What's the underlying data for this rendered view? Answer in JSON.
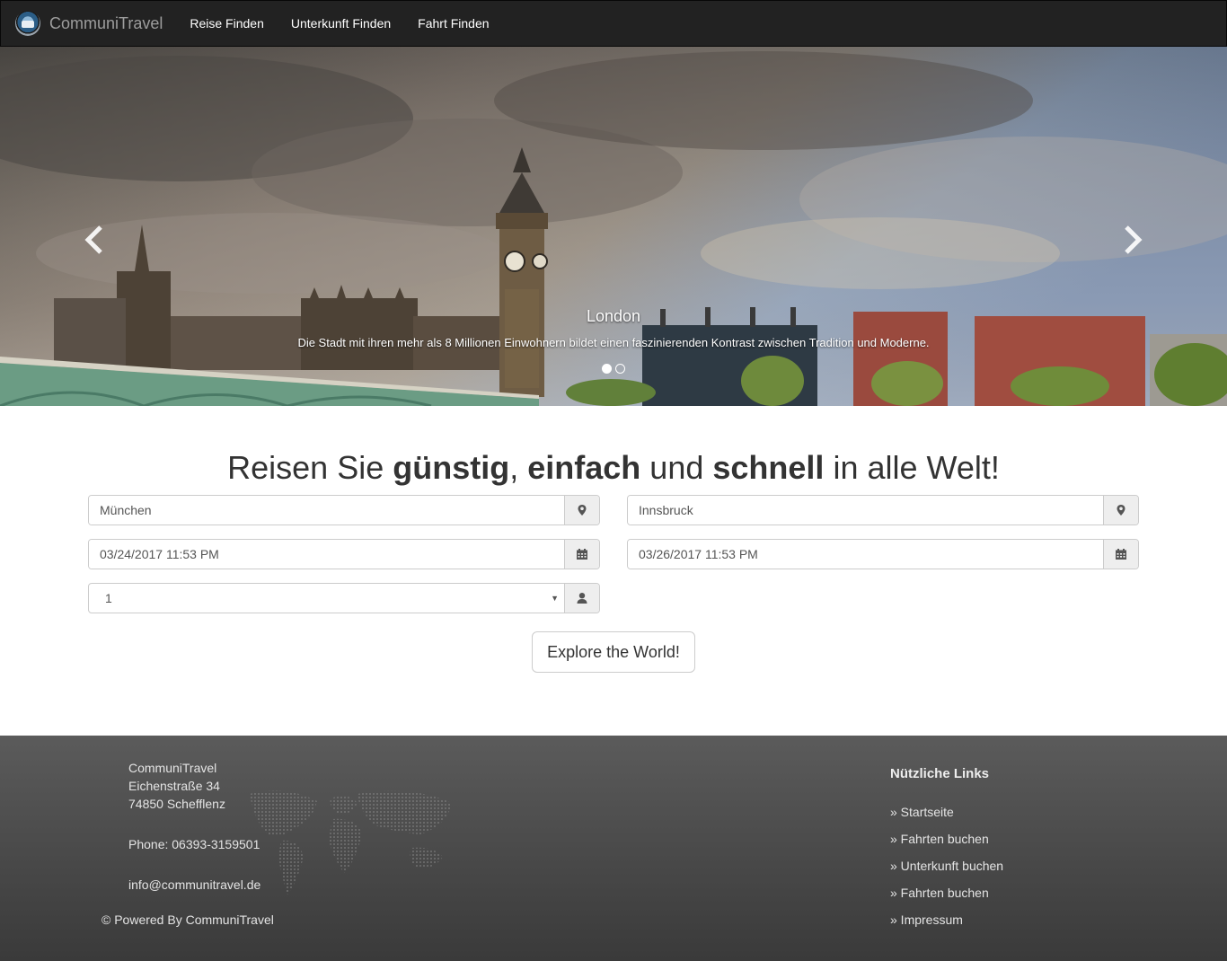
{
  "navbar": {
    "brand": "CommuniTravel",
    "links": [
      "Reise Finden",
      "Unterkunft Finden",
      "Fahrt Finden"
    ]
  },
  "carousel": {
    "caption_title": "London",
    "caption_text": "Die Stadt mit ihren mehr als 8 Millionen Einwohnern bildet einen faszinierenden Kontrast zwischen Tradition und Moderne.",
    "slide_count": 2,
    "active_slide": 1
  },
  "search": {
    "headline": {
      "part1": "Reisen Sie ",
      "bold1": "günstig",
      "part2": ", ",
      "bold2": "einfach",
      "part3": " und ",
      "bold3": "schnell",
      "part4": " in alle Welt!"
    },
    "from": "München",
    "to": "Innsbruck",
    "depart": "03/24/2017 11:53 PM",
    "return": "03/26/2017 11:53 PM",
    "persons": "1",
    "submit": "Explore the World!"
  },
  "footer": {
    "company": "CommuniTravel",
    "street": "Eichenstraße 34",
    "city": "74850 Schefflenz",
    "phone": "Phone: 06393-3159501",
    "email": "info@communitravel.de",
    "powered": "© Powered By CommuniTravel",
    "links_title": "Nützliche Links",
    "links": [
      "» Startseite",
      "» Fahrten buchen",
      "» Unterkunft buchen",
      "» Fahrten buchen",
      "» Impressum"
    ]
  },
  "colors": {
    "navbar_bg": "#222222",
    "footer_bg": "#4a4a4a",
    "text_dark": "#333333"
  },
  "icons": [
    "map-marker-icon",
    "calendar-icon",
    "user-icon",
    "chevron-left-icon",
    "chevron-right-icon",
    "logo-icon"
  ]
}
